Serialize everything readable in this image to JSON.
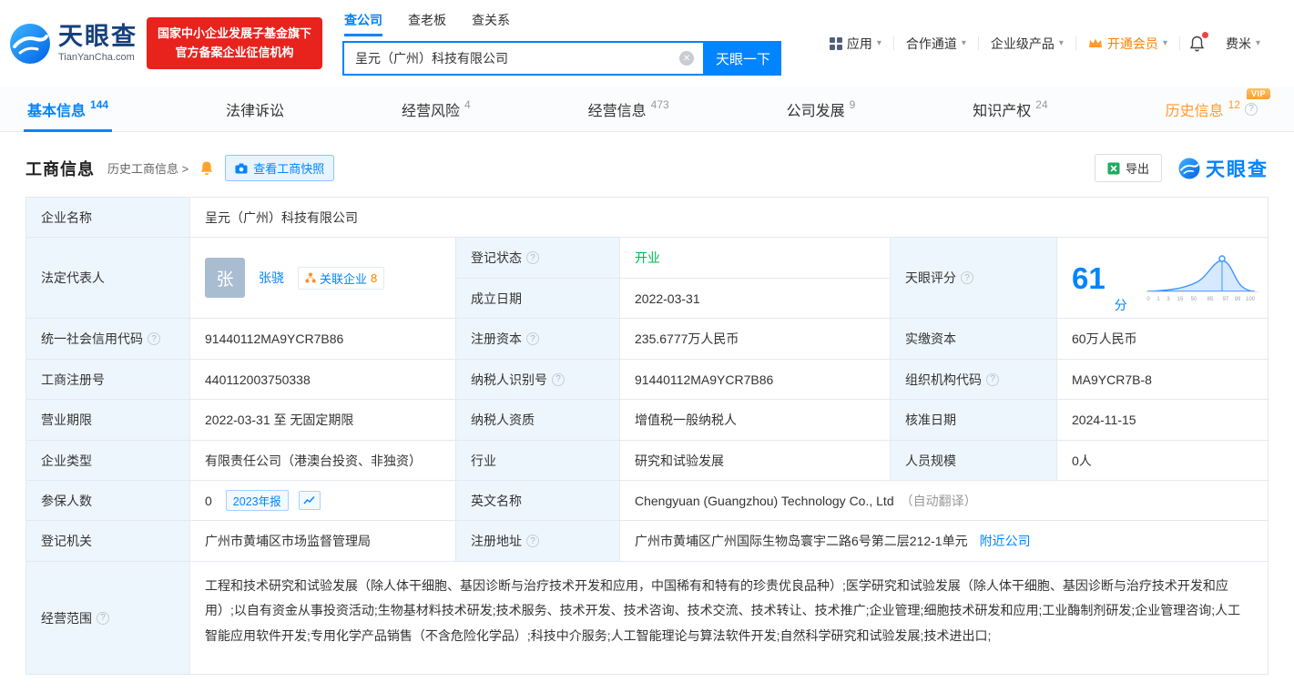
{
  "colors": {
    "brand_blue": "#0084ff",
    "badge_red": "#e8221c",
    "vip_orange": "#ff9a2e",
    "status_green": "#00b550"
  },
  "header": {
    "logo": {
      "name": "天眼查",
      "domain": "TianYanCha.com"
    },
    "badge": {
      "line1": "国家中小企业发展子基金旗下",
      "line2": "官方备案企业征信机构"
    },
    "search": {
      "tabs": [
        {
          "label": "查公司"
        },
        {
          "label": "查老板"
        },
        {
          "label": "查关系"
        }
      ],
      "value": "呈元（广州）科技有限公司",
      "button": "天眼一下"
    },
    "menu": {
      "apps": "应用",
      "cooperation": "合作通道",
      "products": "企业级产品",
      "vip": "开通会员",
      "user": "费米"
    }
  },
  "nav": {
    "tabs": [
      {
        "label": "基本信息",
        "count": "144"
      },
      {
        "label": "法律诉讼",
        "count": ""
      },
      {
        "label": "经营风险",
        "count": "4"
      },
      {
        "label": "经营信息",
        "count": "473"
      },
      {
        "label": "公司发展",
        "count": "9"
      },
      {
        "label": "知识产权",
        "count": "24"
      },
      {
        "label": "历史信息",
        "count": "12",
        "vip_tag": "VIP"
      }
    ]
  },
  "section": {
    "title": "工商信息",
    "history_link": "历史工商信息 >",
    "snapshot_button": "查看工商快照",
    "export_button": "导出",
    "watermark": "天眼查"
  },
  "table": {
    "company_name": {
      "label": "企业名称",
      "value": "呈元（广州）科技有限公司"
    },
    "legal_rep": {
      "label": "法定代表人",
      "avatar": "张",
      "name": "张骁",
      "related_label": "关联企业",
      "related_count": "8"
    },
    "reg_status": {
      "label": "登记状态",
      "value": "开业"
    },
    "establish_date": {
      "label": "成立日期",
      "value": "2022-03-31"
    },
    "tyc_score": {
      "label": "天眼评分"
    },
    "credit_code": {
      "label": "统一社会信用代码",
      "value": "91440112MA9YCR7B86"
    },
    "reg_capital": {
      "label": "注册资本",
      "value": "235.6777万人民币"
    },
    "paid_capital": {
      "label": "实缴资本",
      "value": "60万人民币"
    },
    "reg_number": {
      "label": "工商注册号",
      "value": "440112003750338"
    },
    "taxpayer_id": {
      "label": "纳税人识别号",
      "value": "91440112MA9YCR7B86"
    },
    "org_code": {
      "label": "组织机构代码",
      "value": "MA9YCR7B-8"
    },
    "business_term": {
      "label": "营业期限",
      "value": "2022-03-31 至 无固定期限"
    },
    "taxpayer_quality": {
      "label": "纳税人资质",
      "value": "增值税一般纳税人"
    },
    "approval_date": {
      "label": "核准日期",
      "value": "2024-11-15"
    },
    "company_type": {
      "label": "企业类型",
      "value": "有限责任公司（港澳台投资、非独资）"
    },
    "industry": {
      "label": "行业",
      "value": "研究和试验发展"
    },
    "staff_size": {
      "label": "人员规模",
      "value": "0人"
    },
    "insured_count": {
      "label": "参保人数",
      "value": "0",
      "report_badge": "2023年报"
    },
    "english_name": {
      "label": "英文名称",
      "value": "Chengyuan (Guangzhou) Technology Co., Ltd",
      "note": "（自动翻译）"
    },
    "reg_authority": {
      "label": "登记机关",
      "value": "广州市黄埔区市场监督管理局"
    },
    "reg_address": {
      "label": "注册地址",
      "value": "广州市黄埔区广州国际生物岛寰宇二路6号第二层212-1单元",
      "nearby_link": "附近公司"
    },
    "business_scope": {
      "label": "经营范围",
      "value": "工程和技术研究和试验发展（除人体干细胞、基因诊断与治疗技术开发和应用，中国稀有和特有的珍贵优良品种）;医学研究和试验发展（除人体干细胞、基因诊断与治疗技术开发和应用）;以自有资金从事投资活动;生物基材料技术研发;技术服务、技术开发、技术咨询、技术交流、技术转让、技术推广;企业管理;细胞技术研发和应用;工业酶制剂研发;企业管理咨询;人工智能应用软件开发;专用化学产品销售（不含危险化学品）;科技中介服务;人工智能理论与算法软件开发;自然科学研究和试验发展;技术进出口;"
    }
  },
  "score_chart": {
    "type": "area",
    "score": "61",
    "unit": "分",
    "ticks": [
      "0",
      "1",
      "3",
      "15",
      "50",
      "85",
      "97",
      "99",
      "100"
    ]
  }
}
